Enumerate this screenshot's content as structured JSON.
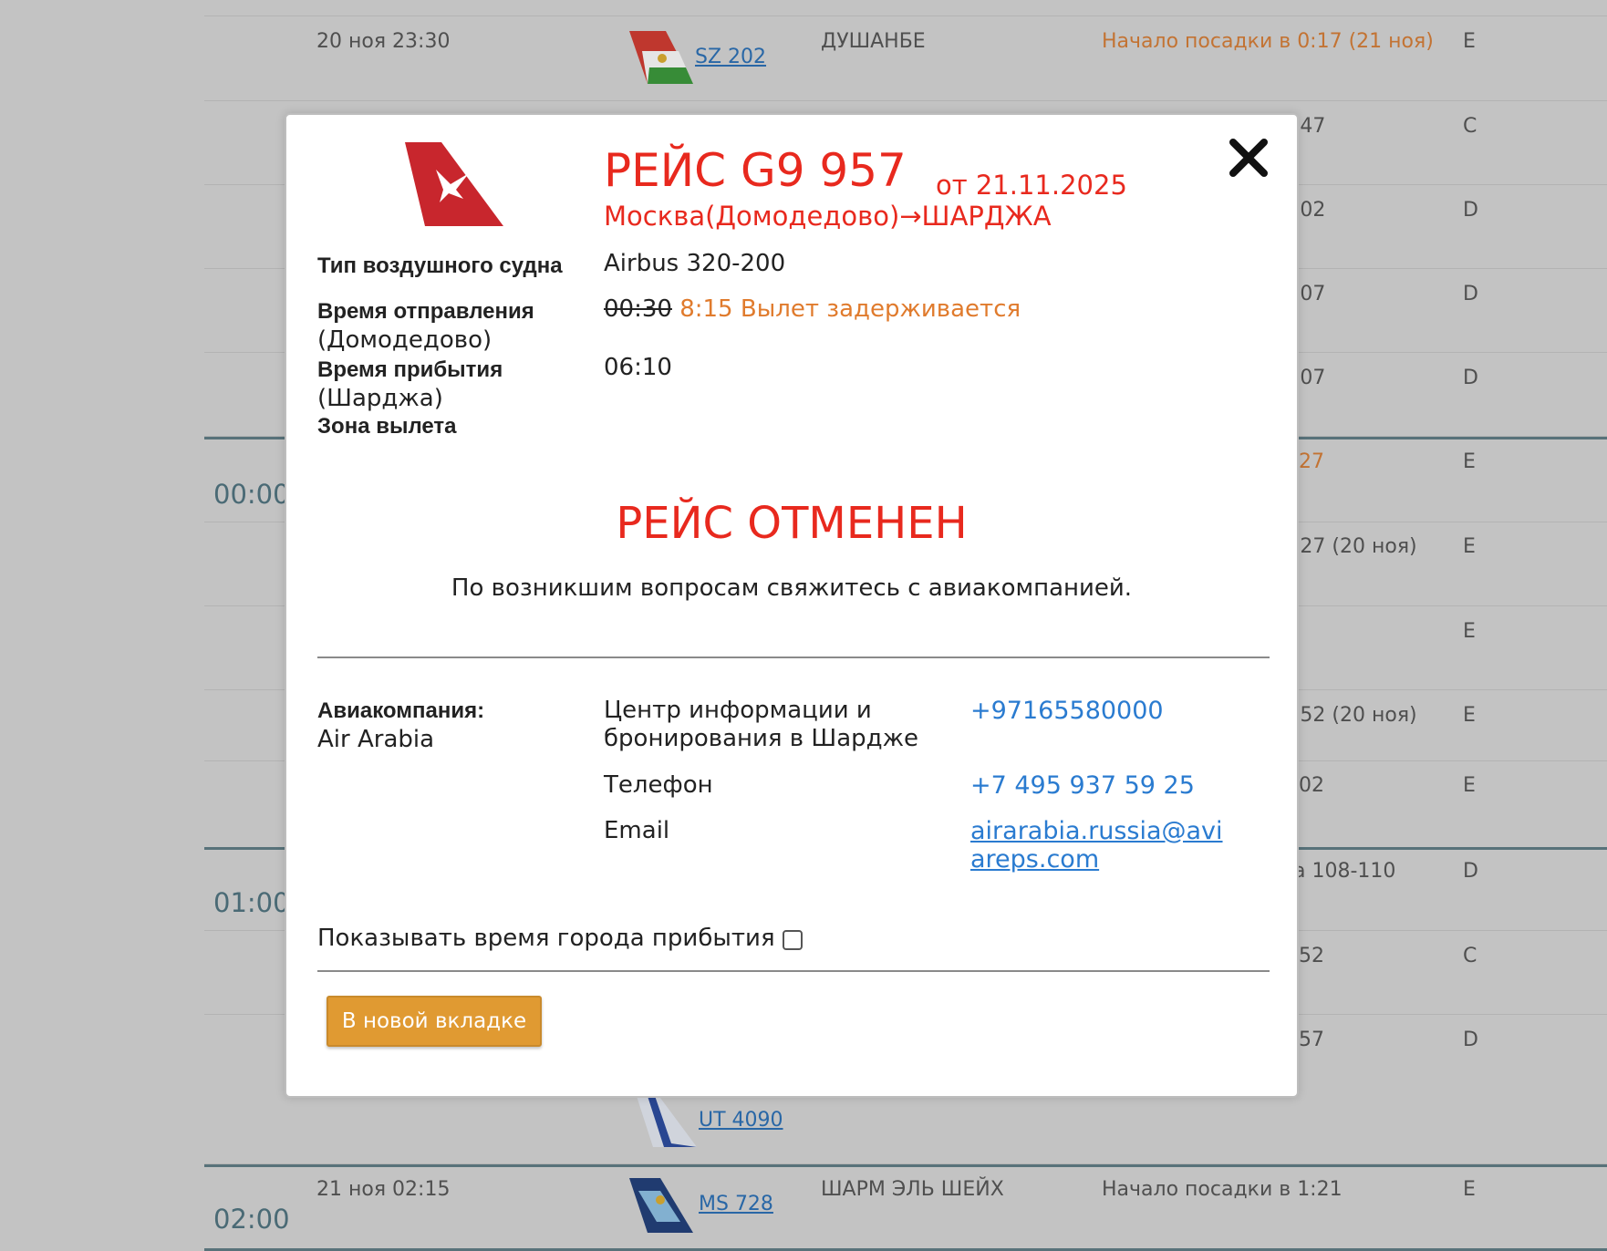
{
  "board": {
    "rows": [
      {
        "date": "20 ноя  23:30",
        "flight": "SZ 202",
        "city": "ДУШАНБЕ",
        "status": "Начало посадки в 0:17 (21 ноя)",
        "terminal": "E",
        "status_orange": true
      },
      {
        "status": ":47",
        "terminal": "C"
      },
      {
        "status": ":02",
        "terminal": "D"
      },
      {
        "status": ":07",
        "terminal": "D"
      },
      {
        "status": ":07",
        "terminal": "D"
      },
      {
        "status": "27",
        "terminal": "E",
        "status_orange": true
      },
      {
        "status": ":27 (20 ноя)",
        "terminal": "E"
      },
      {
        "status": "",
        "terminal": "E"
      },
      {
        "status": ":52 (20 ноя)",
        "terminal": "E"
      },
      {
        "status": "02",
        "terminal": "E"
      },
      {
        "status": "а 108-110",
        "terminal": "D"
      },
      {
        "status": "52",
        "terminal": "C"
      },
      {
        "status": "57",
        "terminal": "D"
      },
      {
        "flight": "UT 4090"
      },
      {
        "date": "21 ноя  02:15",
        "flight": "MS 728",
        "city": "ШАРМ ЭЛЬ ШЕЙХ",
        "status": "Начало посадки в 1:21",
        "terminal": "E"
      }
    ],
    "hours": [
      "00:00",
      "01:00",
      "02:00"
    ]
  },
  "modal": {
    "title": "РЕЙС G9 957",
    "date": "от 21.11.2025",
    "route": "Москва(Домодедово)→ШАРДЖА",
    "aircraft_label": "Тип воздушного судна",
    "aircraft_value": "Airbus 320-200",
    "departure_label": "Время отправления",
    "departure_sub": "(Домодедово)",
    "departure_old": "00:30",
    "departure_new": "8:15 Вылет задерживается",
    "arrival_label": "Время прибытия",
    "arrival_sub": "(Шарджа)",
    "arrival_value": "06:10",
    "zone_label": "Зона вылета",
    "cancelled": "РЕЙС ОТМЕНЕН",
    "cancelled_note": "По возникшим вопросам свяжитесь с авиакомпанией.",
    "airline_label": "Авиакомпания:",
    "airline_value": "Air Arabia",
    "contacts": {
      "info_center_label": "Центр информации и бронирования в Шардже",
      "info_center_phone": "+97165580000",
      "phone_label": "Телефон",
      "phone_value": "+7 495 937 59 25",
      "email_label": "Email",
      "email_value": "airarabia.russia@aviareps.com"
    },
    "show_arrival_time_label": "Показывать время города прибытия",
    "new_tab_button": "В новой вкладке"
  },
  "colors": {
    "accent_red": "#e8291e",
    "link_blue": "#2a7bd0",
    "delay_orange": "#e07b2d",
    "button_orange": "#e09a32"
  }
}
